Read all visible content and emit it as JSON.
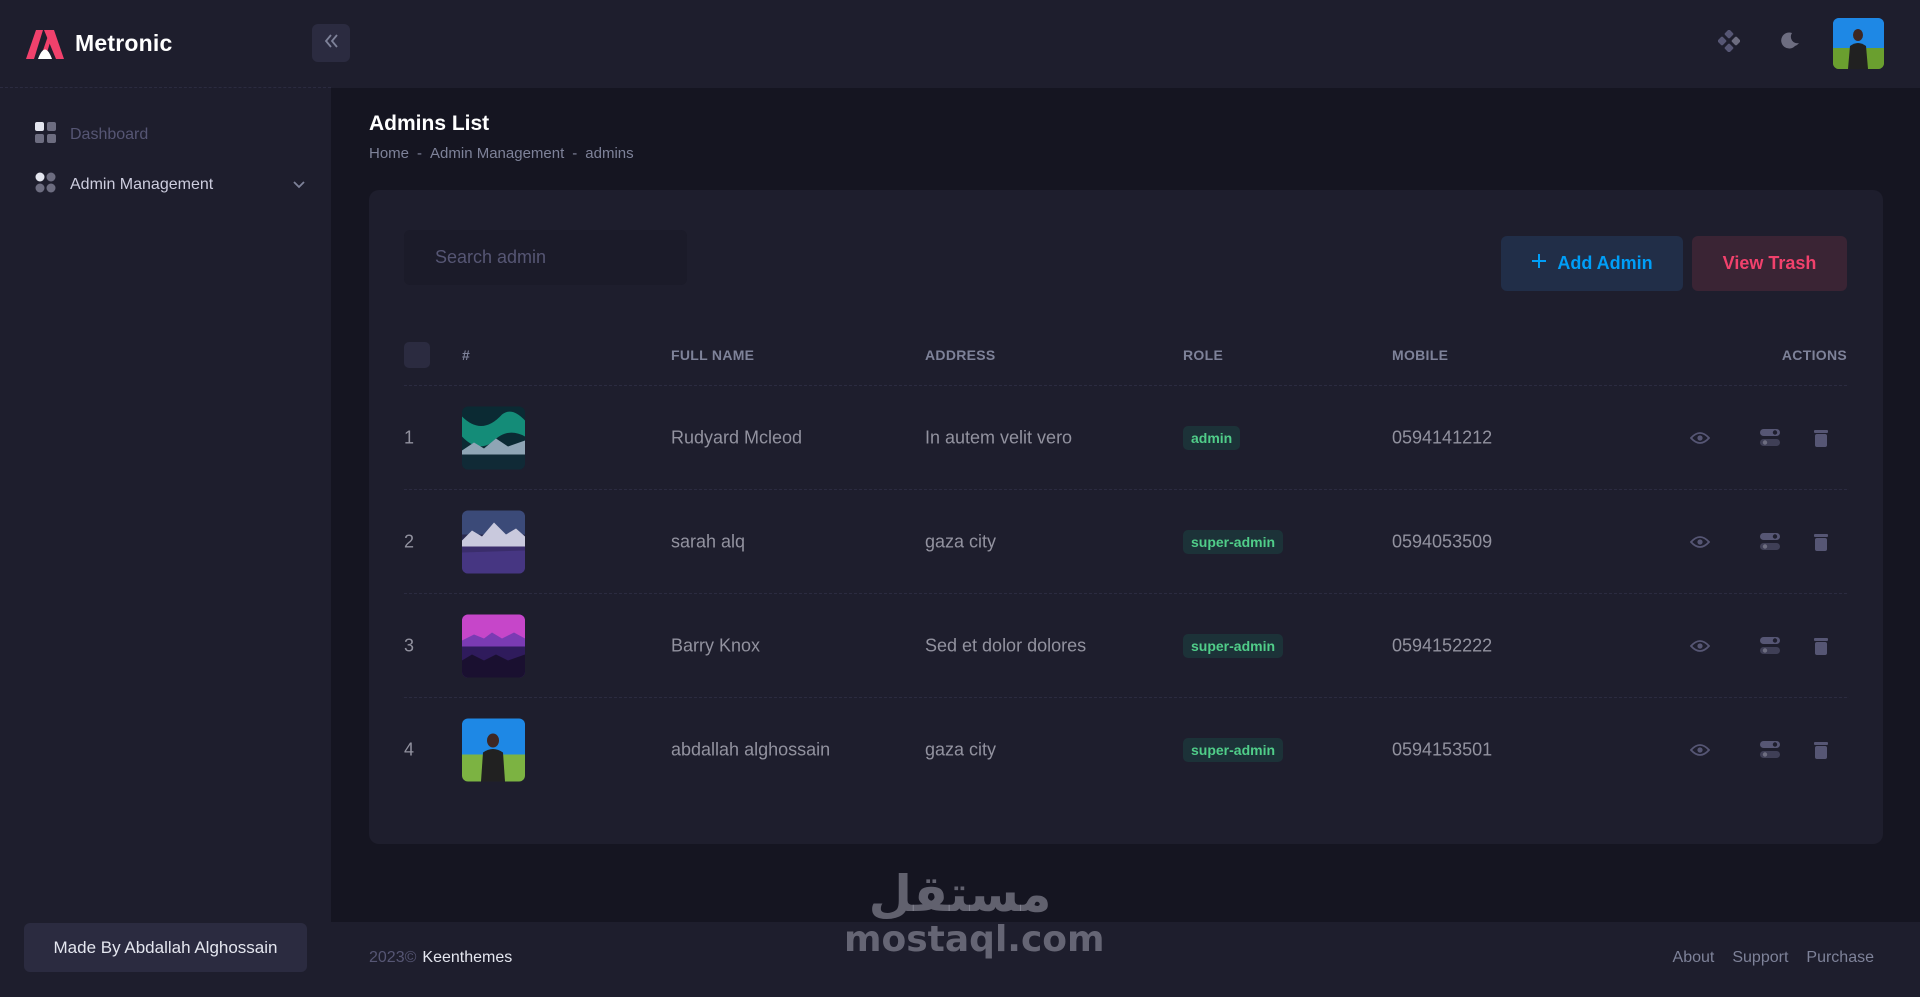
{
  "app": {
    "brand": "Metronic"
  },
  "sidebar": {
    "items": [
      {
        "label": "Dashboard",
        "icon": "dashboard-grid-icon",
        "state": "inactive"
      },
      {
        "label": "Admin Management",
        "icon": "apps-dots-icon",
        "state": "active"
      }
    ],
    "made_by": "Made By Abdallah Alghossain"
  },
  "header": {
    "icons": [
      "collapse-icon",
      "apps-icon",
      "moon-icon",
      "user-avatar"
    ]
  },
  "page": {
    "title": "Admins List",
    "breadcrumb": [
      "Home",
      "Admin Management",
      "admins"
    ],
    "breadcrumb_sep": "-"
  },
  "toolbar": {
    "search_placeholder": "Search admin",
    "add_label": "Add Admin",
    "trash_label": "View Trash"
  },
  "table": {
    "headers": {
      "index": "#",
      "full_name": "FULL NAME",
      "address": "ADDRESS",
      "role": "ROLE",
      "mobile": "MOBILE",
      "actions": "ACTIONS"
    },
    "rows": [
      {
        "n": "1",
        "name": "Rudyard Mcleod",
        "address": "In autem velit vero",
        "role": "admin",
        "mobile": "0594141212",
        "thumb": "aurora"
      },
      {
        "n": "2",
        "name": "sarah alq",
        "address": "gaza city",
        "role": "super-admin",
        "mobile": "0594053509",
        "thumb": "mountains-purple"
      },
      {
        "n": "3",
        "name": "Barry Knox",
        "address": "Sed et dolor dolores",
        "role": "super-admin",
        "mobile": "0594152222",
        "thumb": "synthwave-sunset"
      },
      {
        "n": "4",
        "name": "abdallah alghossain",
        "address": "gaza city",
        "role": "super-admin",
        "mobile": "0594153501",
        "thumb": "man-in-field"
      }
    ]
  },
  "footer": {
    "year": "2023©",
    "company": "Keenthemes",
    "links": [
      "About",
      "Support",
      "Purchase"
    ]
  },
  "watermark": {
    "arabic": "مستقل",
    "latin": "mostaql.com"
  },
  "colors": {
    "bg": "#151521",
    "panel": "#1e1e2d",
    "primary": "#009ef7",
    "danger": "#f1416c",
    "success": "#50cd89"
  }
}
